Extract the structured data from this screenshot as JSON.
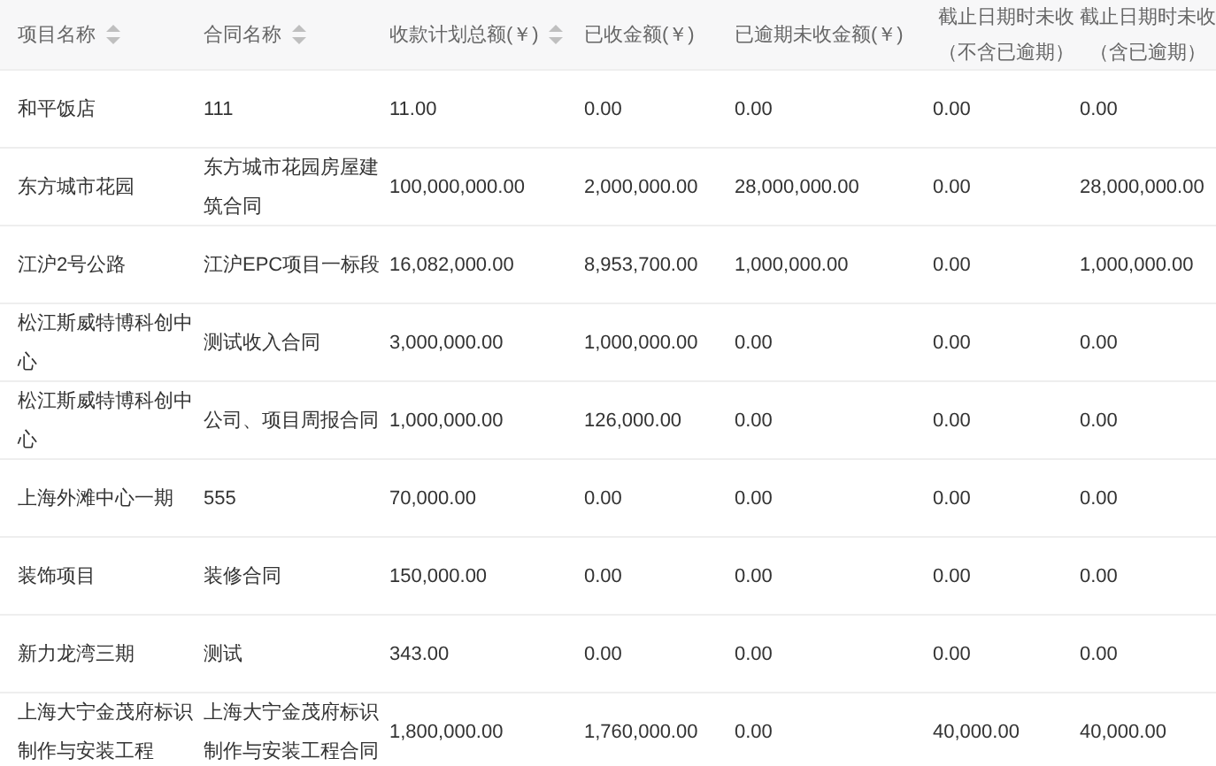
{
  "table": {
    "columns": [
      {
        "label": "项目名称",
        "sortable": true
      },
      {
        "label": "合同名称",
        "sortable": true
      },
      {
        "label": "收款计划总额(￥)",
        "sortable": true
      },
      {
        "label": "已收金额(￥)",
        "sortable": false
      },
      {
        "label": "已逾期未收金额(￥)",
        "sortable": false
      },
      {
        "label": "截止日期时未收（不含已逾期）",
        "sortable": false
      },
      {
        "label": "截止日期时未收（含已逾期）",
        "sortable": false
      }
    ],
    "rows": [
      {
        "cells": [
          "和平饭店",
          "111",
          "11.00",
          "0.00",
          "0.00",
          "0.00",
          "0.00"
        ]
      },
      {
        "cells": [
          "东方城市花园",
          "东方城市花园房屋建筑合同",
          "100,000,000.00",
          "2,000,000.00",
          "28,000,000.00",
          "0.00",
          "28,000,000.00"
        ]
      },
      {
        "cells": [
          "江沪2号公路",
          "江沪EPC项目一标段",
          "16,082,000.00",
          "8,953,700.00",
          "1,000,000.00",
          "0.00",
          "1,000,000.00"
        ]
      },
      {
        "cells": [
          "松江斯威特博科创中心",
          "测试收入合同",
          "3,000,000.00",
          "1,000,000.00",
          "0.00",
          "0.00",
          "0.00"
        ]
      },
      {
        "cells": [
          "松江斯威特博科创中心",
          "公司、项目周报合同",
          "1,000,000.00",
          "126,000.00",
          "0.00",
          "0.00",
          "0.00"
        ]
      },
      {
        "cells": [
          "上海外滩中心一期",
          "555",
          "70,000.00",
          "0.00",
          "0.00",
          "0.00",
          "0.00"
        ]
      },
      {
        "cells": [
          "装饰项目",
          "装修合同",
          "150,000.00",
          "0.00",
          "0.00",
          "0.00",
          "0.00"
        ]
      },
      {
        "cells": [
          "新力龙湾三期",
          "测试",
          "343.00",
          "0.00",
          "0.00",
          "0.00",
          "0.00"
        ]
      },
      {
        "cells": [
          "上海大宁金茂府标识制作与安装工程",
          "上海大宁金茂府标识制作与安装工程合同",
          "1,800,000.00",
          "1,760,000.00",
          "0.00",
          "40,000.00",
          "40,000.00"
        ]
      }
    ]
  }
}
